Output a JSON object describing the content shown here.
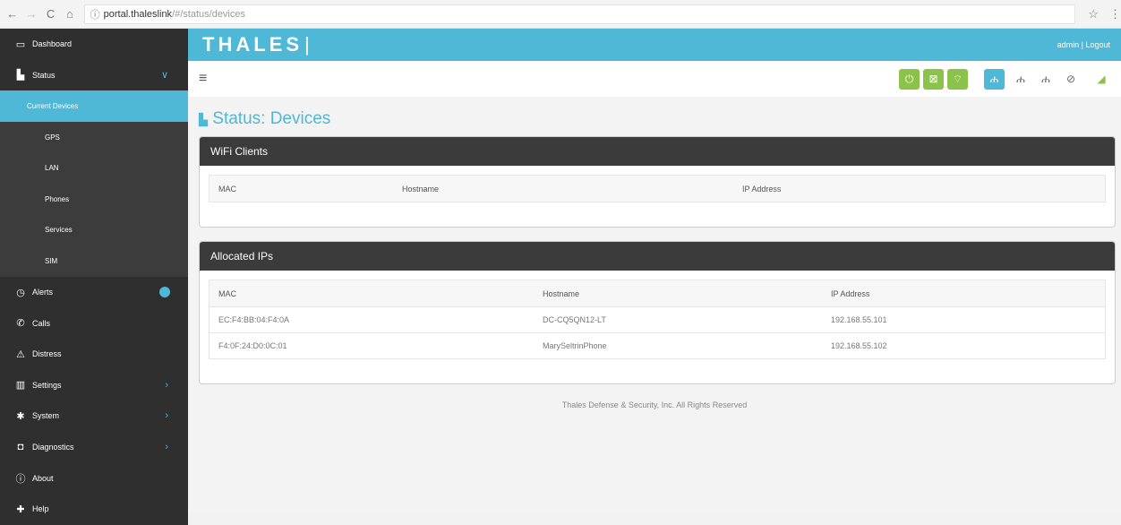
{
  "browser": {
    "back": "←",
    "forward": "→",
    "reload": "C",
    "home": "⌂",
    "info": "ⓘ",
    "url_host": "portal.thaleslink",
    "url_path": "/#/status/devices",
    "star": "☆",
    "menu": "⋮"
  },
  "sidebar": {
    "items": [
      {
        "label": "Dashboard",
        "icon": "▭"
      },
      {
        "label": "Status",
        "icon": "▙"
      },
      {
        "label": "Current Devices"
      },
      {
        "label": "GPS"
      },
      {
        "label": "LAN"
      },
      {
        "label": "Phones"
      },
      {
        "label": "Services"
      },
      {
        "label": "SIM"
      },
      {
        "label": "Alerts",
        "icon": "◷"
      },
      {
        "label": "Calls",
        "icon": "✆"
      },
      {
        "label": "Distress",
        "icon": "⚠"
      },
      {
        "label": "Settings",
        "icon": "▥"
      },
      {
        "label": "System",
        "icon": "✱"
      },
      {
        "label": "Diagnostics",
        "icon": "◘"
      },
      {
        "label": "About",
        "icon": "ⓘ"
      },
      {
        "label": "Help",
        "icon": "✚"
      }
    ],
    "chevron_down": "∨",
    "chevron_right": "›"
  },
  "header": {
    "brand": "THALES",
    "brand_bar": "|",
    "user_links": "admin | Logout"
  },
  "toolbar": {
    "hamburger": "≡",
    "power_icon": "⏻",
    "satellite_icon": "⊠",
    "wifi_icon": "⌔",
    "network_icon": "ሐ",
    "net2_icon": "ሐ",
    "net3_icon": "ሐ",
    "globe_icon": "⊘",
    "signal_icon": "◢"
  },
  "page": {
    "title_icon": "▙",
    "title": "Status: Devices"
  },
  "wifi_clients": {
    "title": "WiFi Clients",
    "columns": [
      "MAC",
      "Hostname",
      "IP Address"
    ]
  },
  "allocated_ips": {
    "title": "Allocated IPs",
    "columns": [
      "MAC",
      "Hostname",
      "IP Address"
    ],
    "rows": [
      [
        "EC:F4:BB:04:F4:0A",
        "DC-CQ5QN12-LT",
        "192.168.55.101"
      ],
      [
        "F4:0F:24:D0:0C:01",
        "MarySeltrinPhone",
        "192.168.55.102"
      ]
    ]
  },
  "footer": "Thales Defense & Security, Inc. All Rights Reserved",
  "colors": {
    "accent": "#4fb8d6",
    "green": "#8bc34a",
    "sidebar": "#3a3a3a",
    "panel_header": "#3b3b3b"
  }
}
